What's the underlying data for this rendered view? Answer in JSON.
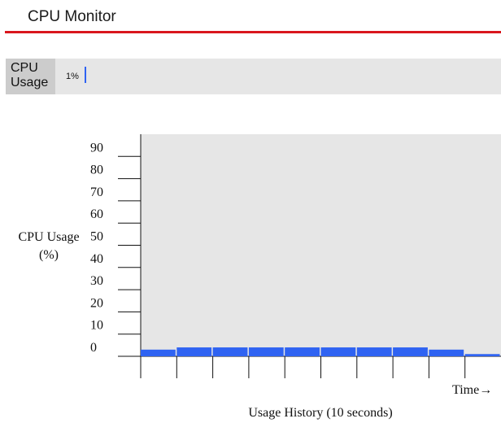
{
  "app": {
    "title": "CPU Monitor"
  },
  "usage": {
    "label_line1": "CPU",
    "label_line2": "Usage",
    "value_text": "1%",
    "value_fraction": 0.01,
    "bar_color": "#2f63f2"
  },
  "colors": {
    "accent_rule": "#d9161d",
    "plot_background": "#e6e6e6",
    "bar": "#2f63f2"
  },
  "chart_data": {
    "type": "bar",
    "title": "",
    "ylabel_line1": "CPU Usage",
    "ylabel_line2": "(%)",
    "xlabel": "Usage History (10 seconds)",
    "x_axis_label": "Time→",
    "yticks": [
      0,
      10,
      20,
      30,
      40,
      50,
      60,
      70,
      80,
      90
    ],
    "ylim": [
      0,
      100
    ],
    "values": [
      3,
      4,
      4,
      4,
      4,
      4,
      4,
      4,
      3,
      1
    ],
    "grid": false
  }
}
